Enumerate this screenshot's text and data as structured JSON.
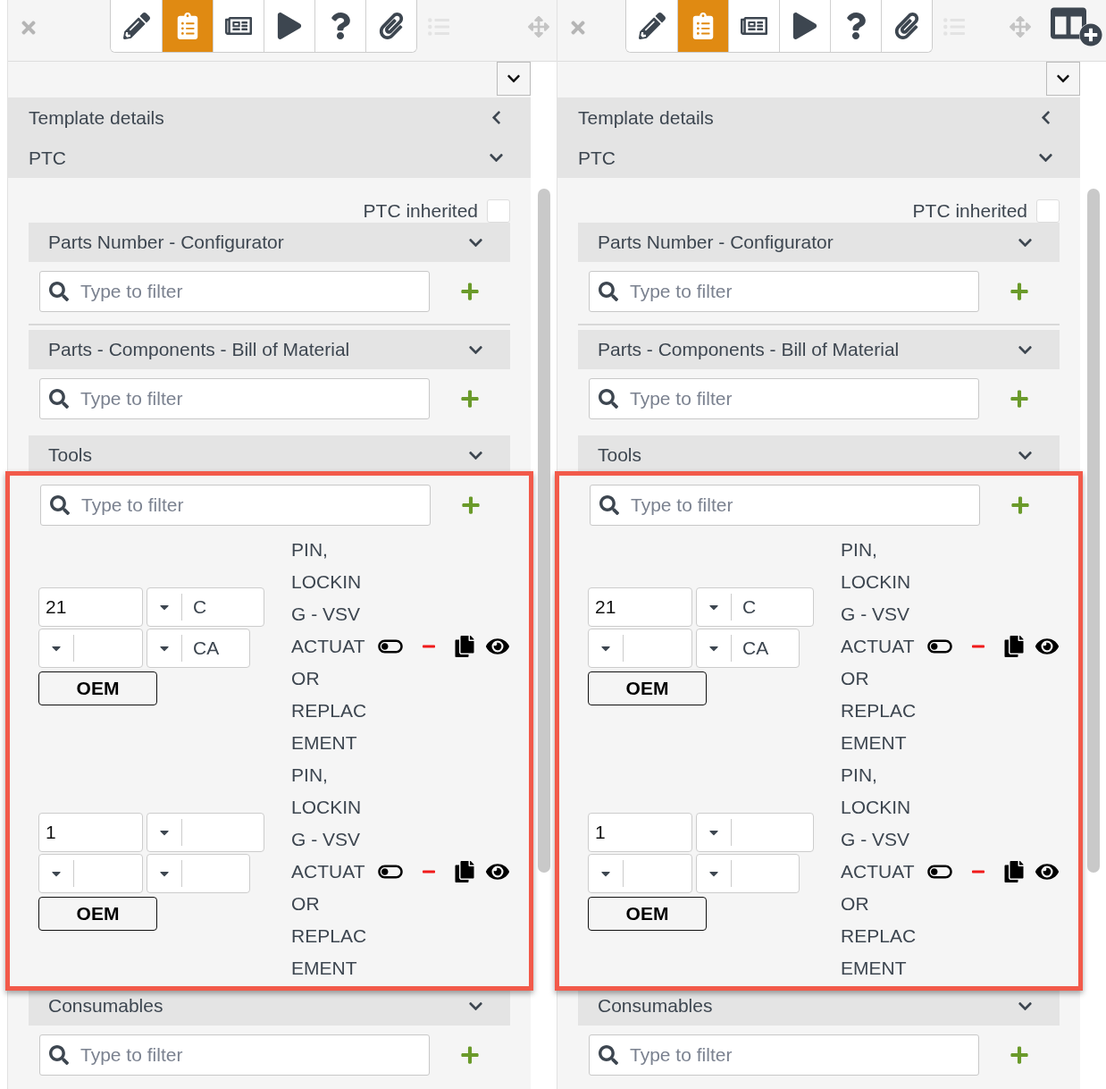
{
  "panels": [
    {
      "toolbar": {
        "buttons": [
          {
            "selected": false
          },
          {
            "selected": true
          },
          {
            "selected": false
          },
          {
            "selected": false
          },
          {
            "selected": false
          },
          {
            "selected": false
          }
        ],
        "list_disabled": true,
        "add_panel_button": false
      },
      "sections": [
        {
          "title": "Template details",
          "expanded": false
        },
        {
          "title": "PTC",
          "expanded": true
        }
      ],
      "inherited": {
        "label": "PTC inherited",
        "checked": false
      },
      "groups": [
        {
          "title": "Parts Number - Configurator",
          "filter_placeholder": "Type to filter",
          "highlighted": false,
          "divider": true
        },
        {
          "title": "Parts - Components - Bill of Material",
          "filter_placeholder": "Type to filter",
          "highlighted": false,
          "divider": false
        },
        {
          "title": "Tools",
          "filter_placeholder": "Type to filter",
          "highlighted": true,
          "divider": false,
          "items": [
            {
              "quantity": "21",
              "select_1": "C",
              "select_3": "CA",
              "button": "OEM",
              "description": "PIN,\nLOCKIN\nG - VSV\nACTUAT\nOR\nREPLAC\nEMENT"
            },
            {
              "quantity": "1",
              "button": "OEM",
              "description": "PIN,\nLOCKIN\nG - VSV\nACTUAT\nOR\nREPLAC\nEMENT"
            }
          ]
        },
        {
          "title": "Consumables",
          "filter_placeholder": "Type to filter",
          "highlighted": false,
          "divider": false
        }
      ]
    },
    {
      "toolbar": {
        "buttons": [
          {
            "selected": false
          },
          {
            "selected": true
          },
          {
            "selected": false
          },
          {
            "selected": false
          },
          {
            "selected": false
          },
          {
            "selected": false
          }
        ],
        "list_disabled": true,
        "add_panel_button": true
      },
      "sections": [
        {
          "title": "Template details",
          "expanded": false
        },
        {
          "title": "PTC",
          "expanded": true
        }
      ],
      "inherited": {
        "label": "PTC inherited",
        "checked": false
      },
      "groups": [
        {
          "title": "Parts Number - Configurator",
          "filter_placeholder": "Type to filter",
          "highlighted": false,
          "divider": true
        },
        {
          "title": "Parts - Components - Bill of Material",
          "filter_placeholder": "Type to filter",
          "highlighted": false,
          "divider": false
        },
        {
          "title": "Tools",
          "filter_placeholder": "Type to filter",
          "highlighted": true,
          "divider": false,
          "items": [
            {
              "quantity": "21",
              "select_1": "C",
              "select_3": "CA",
              "button": "OEM",
              "description": "PIN,\nLOCKIN\nG - VSV\nACTUAT\nOR\nREPLAC\nEMENT"
            },
            {
              "quantity": "1",
              "button": "OEM",
              "description": "PIN,\nLOCKIN\nG - VSV\nACTUAT\nOR\nREPLAC\nEMENT"
            }
          ]
        },
        {
          "title": "Consumables",
          "filter_placeholder": "Type to filter",
          "highlighted": false,
          "divider": false
        }
      ]
    }
  ]
}
